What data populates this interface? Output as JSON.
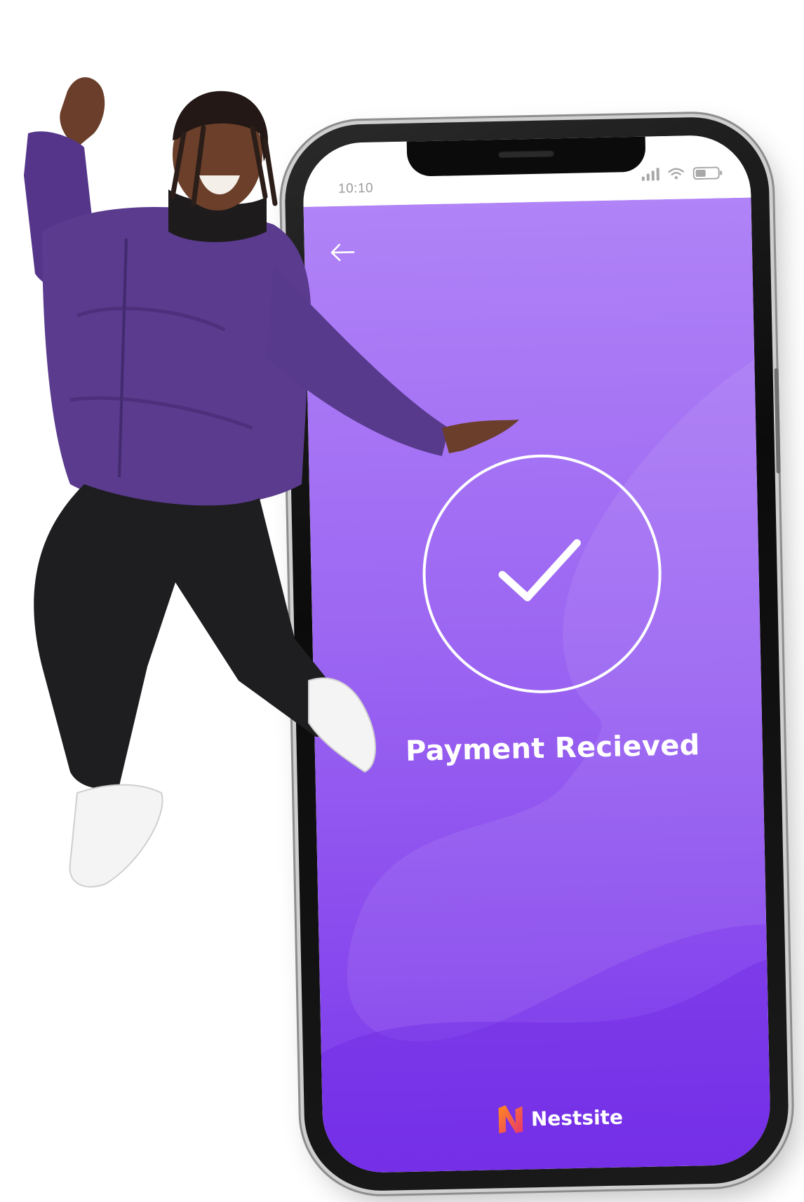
{
  "status_bar": {
    "time": "10:10",
    "icons": [
      "signal-icon",
      "wifi-icon",
      "battery-icon"
    ]
  },
  "app": {
    "back_icon": "arrow-left-icon",
    "success_icon": "checkmark-icon",
    "title": "Payment Recieved",
    "brand_name": "Nestsite",
    "colors": {
      "background_top": "#b083f7",
      "background_bottom": "#7a36ea",
      "text": "#ffffff",
      "brand_logo_start": "#ff8a1f",
      "brand_logo_end": "#e8366b"
    }
  },
  "photo": {
    "subject": "person-jumping",
    "jacket_color": "#5b3c8f",
    "pants_color": "#1c1c1e",
    "shoes_color": "#f2f2f2"
  }
}
